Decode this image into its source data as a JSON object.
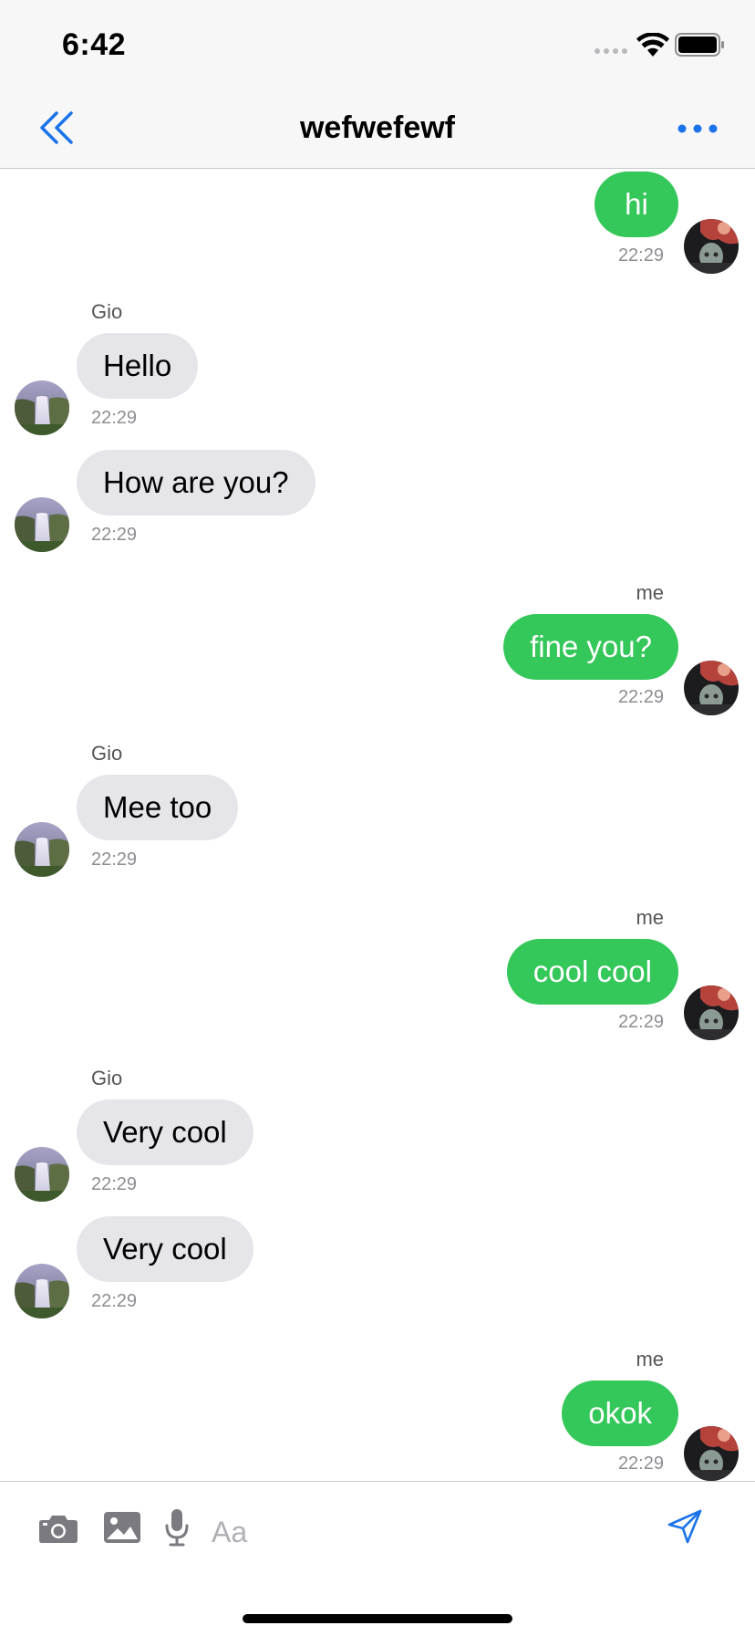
{
  "status_bar": {
    "time": "6:42"
  },
  "nav": {
    "title": "wefwefewf",
    "accent_color": "#1a73e8"
  },
  "colors": {
    "outgoing_bubble": "#34c759",
    "incoming_bubble": "#e5e5ea"
  },
  "messages": [
    {
      "direction": "out",
      "sender": "",
      "text": "hi",
      "time": "22:29"
    },
    {
      "direction": "in",
      "sender": "Gio",
      "text": "Hello",
      "time": "22:29"
    },
    {
      "direction": "in",
      "sender": "",
      "text": "How are you?",
      "time": "22:29"
    },
    {
      "direction": "out",
      "sender": "me",
      "text": "fine you?",
      "time": "22:29"
    },
    {
      "direction": "in",
      "sender": "Gio",
      "text": "Mee too",
      "time": "22:29"
    },
    {
      "direction": "out",
      "sender": "me",
      "text": "cool cool",
      "time": "22:29"
    },
    {
      "direction": "in",
      "sender": "Gio",
      "text": "Very cool",
      "time": "22:29"
    },
    {
      "direction": "in",
      "sender": "",
      "text": "Very cool",
      "time": "22:29"
    },
    {
      "direction": "out",
      "sender": "me",
      "text": "okok",
      "time": "22:29"
    }
  ],
  "input": {
    "placeholder": "Aa",
    "value": ""
  },
  "icons": {
    "back": "double-chevron-left-icon",
    "more": "more-dots-icon",
    "camera": "camera-icon",
    "image": "image-icon",
    "mic": "microphone-icon",
    "send": "send-icon"
  }
}
